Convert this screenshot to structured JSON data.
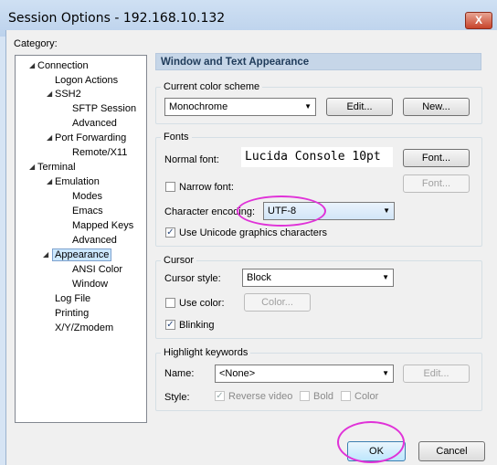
{
  "window": {
    "title": "Session Options - 192.168.10.132",
    "close_glyph": "X"
  },
  "category_label": "Category:",
  "tree": [
    {
      "label": "Connection",
      "expanded": true
    },
    {
      "label": "Logon Actions"
    },
    {
      "label": "SSH2",
      "expanded": true
    },
    {
      "label": "SFTP Session"
    },
    {
      "label": "Advanced"
    },
    {
      "label": "Port Forwarding",
      "expanded": true
    },
    {
      "label": "Remote/X11"
    },
    {
      "label": "Terminal",
      "expanded": true
    },
    {
      "label": "Emulation",
      "expanded": true
    },
    {
      "label": "Modes"
    },
    {
      "label": "Emacs"
    },
    {
      "label": "Mapped Keys"
    },
    {
      "label": "Advanced"
    },
    {
      "label": "Appearance",
      "selected": true
    },
    {
      "label": "ANSI Color"
    },
    {
      "label": "Window"
    },
    {
      "label": "Log File"
    },
    {
      "label": "Printing"
    },
    {
      "label": "X/Y/Zmodem"
    }
  ],
  "panel": {
    "header": "Window and Text Appearance",
    "color_scheme": {
      "title": "Current color scheme",
      "value": "Monochrome",
      "edit": "Edit...",
      "new": "New..."
    },
    "fonts": {
      "title": "Fonts",
      "normal_font_label": "Normal font:",
      "normal_font_value": "Lucida Console 10pt",
      "font_button": "Font...",
      "narrow_font_label": "Narrow font:",
      "narrow_font_button": "Font...",
      "encoding_label": "Character encoding:",
      "encoding_value": "UTF-8",
      "unicode_label": "Use Unicode graphics characters"
    },
    "cursor": {
      "title": "Cursor",
      "style_label": "Cursor style:",
      "style_value": "Block",
      "use_color_label": "Use color:",
      "color_button": "Color...",
      "blinking_label": "Blinking"
    },
    "highlight": {
      "title": "Highlight keywords",
      "name_label": "Name:",
      "name_value": "<None>",
      "edit_button": "Edit...",
      "style_label": "Style:",
      "reverse_label": "Reverse video",
      "bold_label": "Bold",
      "color_label": "Color"
    }
  },
  "buttons": {
    "ok": "OK",
    "cancel": "Cancel"
  },
  "colors": {
    "accent_ring": "#e032d8",
    "selected_bg": "#cce8ff"
  }
}
